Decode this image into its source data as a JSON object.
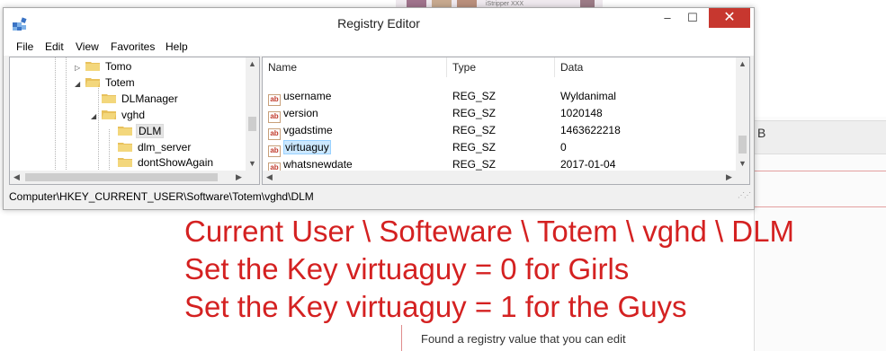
{
  "background": {
    "top_caption": "iStripper XXX",
    "bottom_text": "Found a registry value that you can edit",
    "right_mark": "B"
  },
  "window": {
    "title": "Registry Editor",
    "controls": {
      "minimize": "–",
      "maximize": "☐",
      "close": "✕"
    }
  },
  "menu": [
    "File",
    "Edit",
    "View",
    "Favorites",
    "Help"
  ],
  "tree": [
    {
      "label": "Tomo",
      "expander": "▷"
    },
    {
      "label": "Totem",
      "expander": "◢"
    },
    {
      "label": "DLManager"
    },
    {
      "label": "vghd",
      "expander": "◢"
    },
    {
      "label": "DLM",
      "selected": true
    },
    {
      "label": "dlm_server"
    },
    {
      "label": "dontShowAgain"
    }
  ],
  "columns": {
    "name": "Name",
    "type": "Type",
    "data": "Data"
  },
  "values": [
    {
      "name": "username",
      "type": "REG_SZ",
      "data": "Wyldanimal"
    },
    {
      "name": "version",
      "type": "REG_SZ",
      "data": "1020148"
    },
    {
      "name": "vgadstime",
      "type": "REG_SZ",
      "data": "1463622218"
    },
    {
      "name": "virtuaguy",
      "type": "REG_SZ",
      "data": "0",
      "selected": true
    },
    {
      "name": "whatsnewdate",
      "type": "REG_SZ",
      "data": "2017-01-04"
    }
  ],
  "status_path": "Computer\\HKEY_CURRENT_USER\\Software\\Totem\\vghd\\DLM",
  "annotation": [
    "Current User \\ Softeware \\ Totem \\ vghd \\ DLM",
    "Set the Key virtuaguy = 0 for Girls",
    "Set the Key virtuaguy = 1 for the Guys"
  ],
  "colors": {
    "annotation": "#d42121",
    "close_button": "#c7372f",
    "selection": "#cce8ff"
  }
}
